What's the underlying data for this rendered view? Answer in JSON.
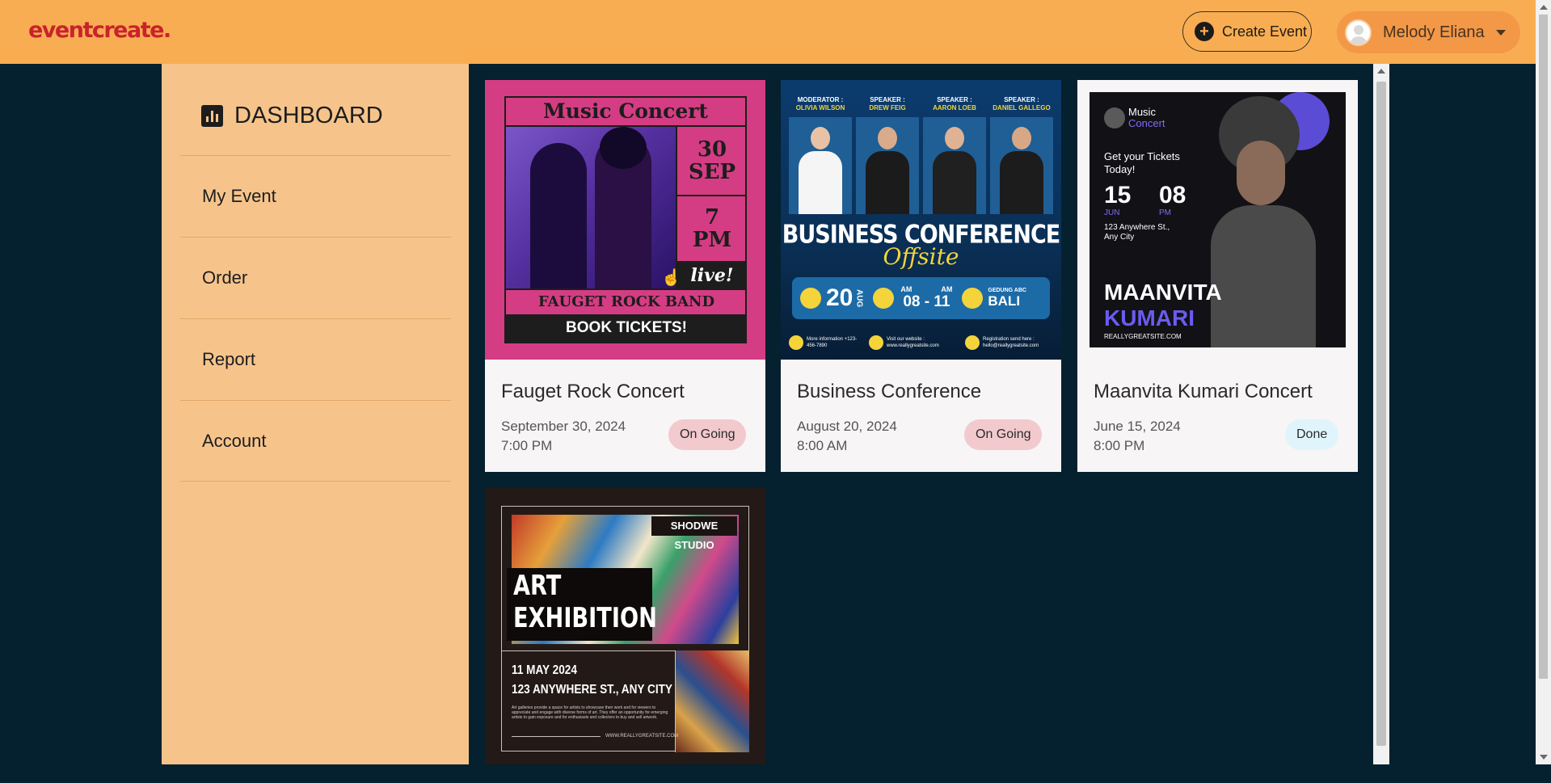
{
  "header": {
    "logo": "eventcreate.",
    "create_event_label": "Create Event",
    "user_name": "Melody Eliana"
  },
  "sidebar": {
    "title": "DASHBOARD",
    "items": [
      {
        "label": "My Event"
      },
      {
        "label": "Order"
      },
      {
        "label": "Report"
      },
      {
        "label": "Account"
      }
    ]
  },
  "events": [
    {
      "title": "Fauget Rock Concert",
      "date": "September 30, 2024",
      "time": "7:00 PM",
      "status": "On Going",
      "poster": {
        "heading": "Music Concert",
        "day": "30",
        "month": "SEP",
        "hour": "7",
        "ampm": "PM",
        "live": "live!",
        "band": "FAUGET ROCK BAND",
        "cta": "BOOK TICKETS!"
      }
    },
    {
      "title": "Business Conference",
      "date": "August 20, 2024",
      "time": "8:00 AM",
      "status": "On Going",
      "poster": {
        "roles": [
          {
            "role": "MODERATOR :",
            "name": "OLIVIA WILSON"
          },
          {
            "role": "SPEAKER :",
            "name": "DREW FEIG"
          },
          {
            "role": "SPEAKER :",
            "name": "AARON LOEB"
          },
          {
            "role": "SPEAKER :",
            "name": "DANIEL GALLEGO"
          }
        ],
        "heading": "BUSINESS CONFERENCE",
        "script": "Offsite",
        "day": "20",
        "month": "AUG",
        "time_range": "08 - 11",
        "am1": "AM",
        "am2": "AM",
        "venue_small": "GEDUNG ABC",
        "venue": "BALI",
        "info": "More information +123-456-7890",
        "website": "Visit our website : www.reallygreatsite.com",
        "register": "Registration send here : hello@reallygreatsite.com"
      }
    },
    {
      "title": "Maanvita Kumari Concert",
      "date": "June 15, 2024",
      "time": "8:00 PM",
      "status": "Done",
      "poster": {
        "brand1": "Music",
        "brand2": "Concert",
        "tagline": "Get your Tickets Today!",
        "day": "15",
        "month": "JUN",
        "hour": "08",
        "ampm": "PM",
        "address": "123 Anywhere St., Any City",
        "name1": "MAANVITA",
        "name2": "KUMARI",
        "site": "REALLYGREATSITE.COM"
      }
    },
    {
      "poster": {
        "studio": "SHODWE STUDIO",
        "heading1": "ART",
        "heading2": "EXHIBITION",
        "date": "11 MAY 2024",
        "address": "123 ANYWHERE ST., ANY CITY",
        "body": "Art galleries provide a space for artists to showcase their work and for viewers to appreciate and engage with diverse forms of art. They offer an opportunity for emerging artists to gain exposure and for enthusiasts and collectors to buy and sell artwork.",
        "site": "WWW.REALLYGREATSITE.COM"
      }
    }
  ]
}
